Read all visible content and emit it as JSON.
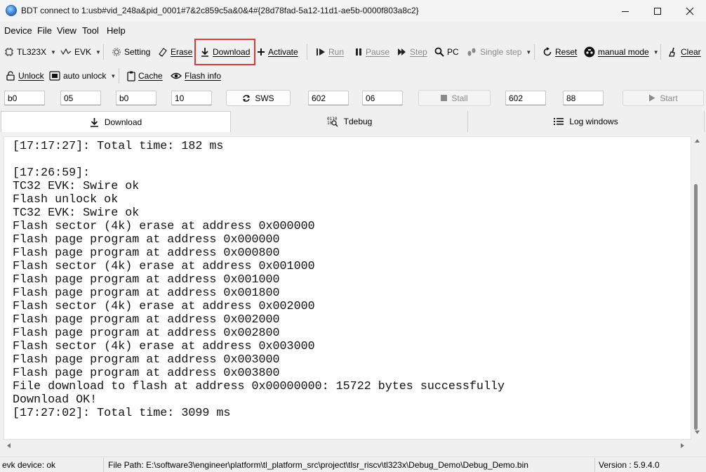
{
  "window": {
    "title": "BDT connect to 1:usb#vid_248a&pid_0001#7&2c859c5a&0&4#{28d78fad-5a12-11d1-ae5b-0000f803a8c2}",
    "icon": "globe-app-icon",
    "controls": [
      "minimize-icon",
      "maximize-icon",
      "close-icon"
    ]
  },
  "menu": [
    "Device",
    "File",
    "View",
    "Tool",
    "Help"
  ],
  "toolbar1": {
    "chip": "TL323X",
    "board": "EVK",
    "setting": "Setting",
    "erase": "Erase",
    "download": "Download",
    "activate": "Activate",
    "run": "Run",
    "pause": "Pause",
    "step": "Step",
    "pc": "PC",
    "single_step": "Single step",
    "reset": "Reset",
    "mode": "manual mode",
    "clear": "Clear"
  },
  "toolbar2": {
    "unlock": "Unlock",
    "auto_unlock": "auto unlock",
    "cache": "Cache",
    "flash_info": "Flash info"
  },
  "inputs": {
    "f1": "b0",
    "f2": "05",
    "f3": "b0",
    "f4": "10",
    "sws": "SWS",
    "f5": "602",
    "f6": "06",
    "stall": "Stall",
    "f7": "602",
    "f8": "88",
    "start": "Start"
  },
  "tabs": [
    "Download",
    "Tdebug",
    "Log windows"
  ],
  "log": [
    "[17:17:27]: Total time: 182 ms",
    "",
    "[17:26:59]:",
    "TC32 EVK: Swire ok",
    "Flash unlock ok",
    "TC32 EVK: Swire ok",
    "Flash sector (4k) erase at address 0x000000",
    "Flash page program at address 0x000000",
    "Flash page program at address 0x000800",
    "Flash sector (4k) erase at address 0x001000",
    "Flash page program at address 0x001000",
    "Flash page program at address 0x001800",
    "Flash sector (4k) erase at address 0x002000",
    "Flash page program at address 0x002000",
    "Flash page program at address 0x002800",
    "Flash sector (4k) erase at address 0x003000",
    "Flash page program at address 0x003000",
    "Flash page program at address 0x003800",
    "File download to flash at address 0x00000000: 15722 bytes successfully",
    "Download OK!",
    "[17:27:02]: Total time: 3099 ms"
  ],
  "status": {
    "device": "evk device: ok",
    "file_path": "File Path:  E:\\software3\\engineer\\platform\\tl_platform_src\\project\\tlsr_riscv\\tl323x\\Debug_Demo\\Debug_Demo.bin",
    "version": "Version : 5.9.4.0"
  },
  "colors": {
    "highlight": "#d83a3a",
    "background": "#f0f0f0"
  }
}
